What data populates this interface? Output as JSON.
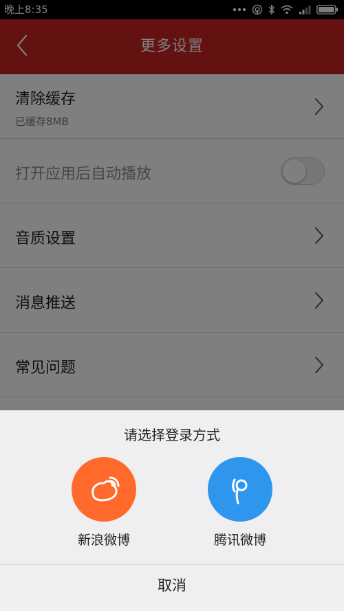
{
  "status_bar": {
    "time": "晚上8:35",
    "icons": [
      "dots-icon",
      "hotspot-icon",
      "bluetooth-icon",
      "wifi-icon",
      "signal-icon",
      "battery-icon"
    ]
  },
  "header": {
    "title": "更多设置",
    "back_icon": "chevron-left-icon",
    "background": "#c72222"
  },
  "settings": [
    {
      "label": "清除缓存",
      "sublabel": "已缓存8MB",
      "control": "chevron"
    },
    {
      "label": "打开应用后自动播放",
      "control": "toggle",
      "toggle_on": false
    },
    {
      "label": "音质设置",
      "control": "chevron"
    },
    {
      "label": "消息推送",
      "control": "chevron"
    },
    {
      "label": "常见问题",
      "control": "chevron"
    }
  ],
  "login_sheet": {
    "title": "请选择登录方式",
    "options": [
      {
        "label": "新浪微博",
        "icon": "weibo-icon",
        "color": "#ff6a2c"
      },
      {
        "label": "腾讯微博",
        "icon": "tencent-weibo-icon",
        "color": "#2f96ee"
      }
    ],
    "cancel_label": "取消"
  }
}
